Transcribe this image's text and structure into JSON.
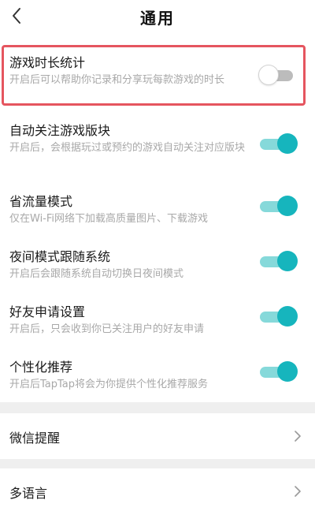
{
  "header": {
    "title": "通用"
  },
  "settings": [
    {
      "name": "游戏时长统计",
      "desc": "开启后可以帮助你记录和分享玩每款游戏的时长",
      "enabled": false,
      "highlighted": true
    },
    {
      "name": "自动关注游戏版块",
      "desc": "开启后，会根据玩过或预约的游戏自动关注对应版块",
      "enabled": true
    },
    {
      "name": "省流量模式",
      "desc": "仅在Wi-Fi网络下加载高质量图片、下载游戏",
      "enabled": true
    },
    {
      "name": "夜间模式跟随系统",
      "desc": "开启后会跟随系统自动切换日夜间模式",
      "enabled": true
    },
    {
      "name": "好友申请设置",
      "desc": "开启后，只会收到你已关注用户的好友申请",
      "enabled": true
    },
    {
      "name": "个性化推荐",
      "desc": "开启后TapTap将会为你提供个性化推荐服务",
      "enabled": true
    }
  ],
  "nav": [
    {
      "label": "微信提醒"
    },
    {
      "label": "多语言"
    }
  ],
  "colors": {
    "accent": "#16b5bd",
    "accent_track": "#86d9da",
    "highlight_border": "#e5555f"
  },
  "icons": {
    "back": "chevron-left-icon",
    "nav_arrow": "chevron-right-icon"
  }
}
